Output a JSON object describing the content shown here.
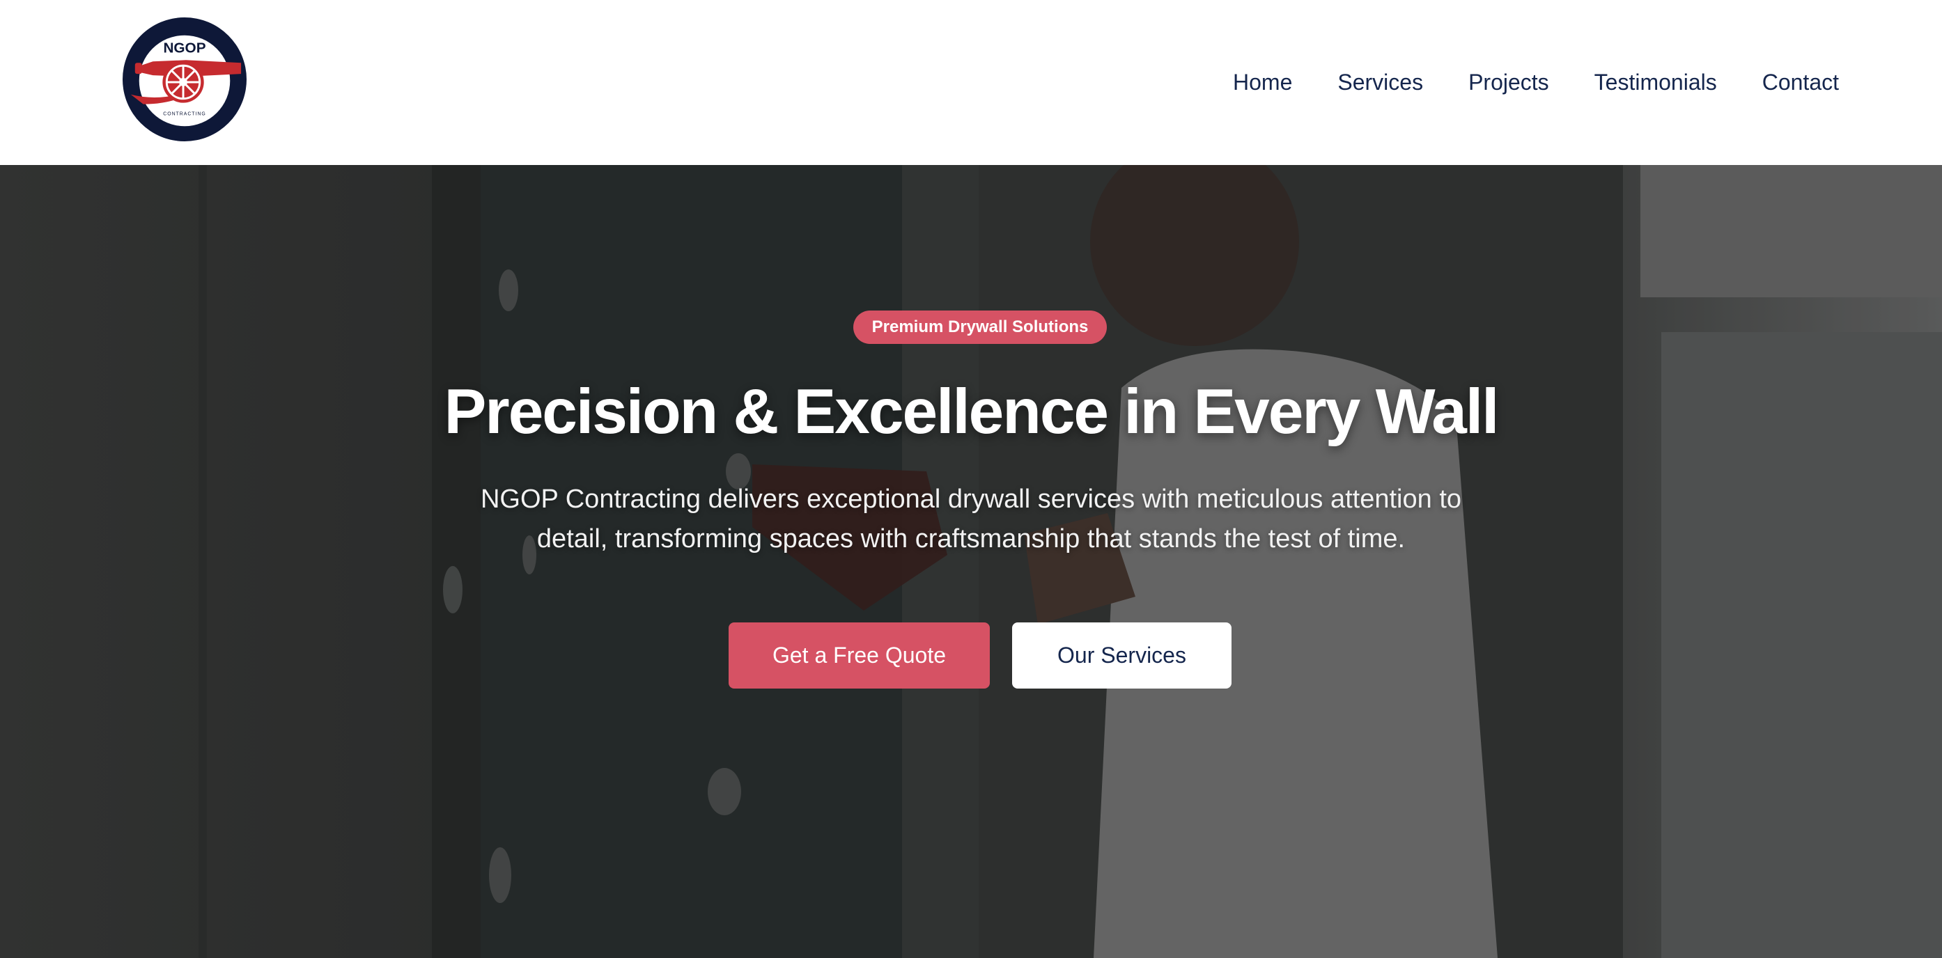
{
  "brand": {
    "logo_text": "NGOP",
    "logo_subtext": "CONTRACTING",
    "navy": "#0e1838",
    "accent": "#d65264",
    "logo_red": "#c62b2f"
  },
  "nav": {
    "items": [
      {
        "label": "Home"
      },
      {
        "label": "Services"
      },
      {
        "label": "Projects"
      },
      {
        "label": "Testimonials"
      },
      {
        "label": "Contact"
      }
    ]
  },
  "hero": {
    "badge": "Premium Drywall Solutions",
    "title": "Precision & Excellence in Every Wall",
    "subtitle": "NGOP Contracting delivers exceptional drywall services with meticulous attention to detail, transforming spaces with craftsmanship that stands the test of time.",
    "primary_cta": "Get a Free Quote",
    "secondary_cta": "Our Services",
    "background_image": "worker-drilling-drywall-photo"
  }
}
